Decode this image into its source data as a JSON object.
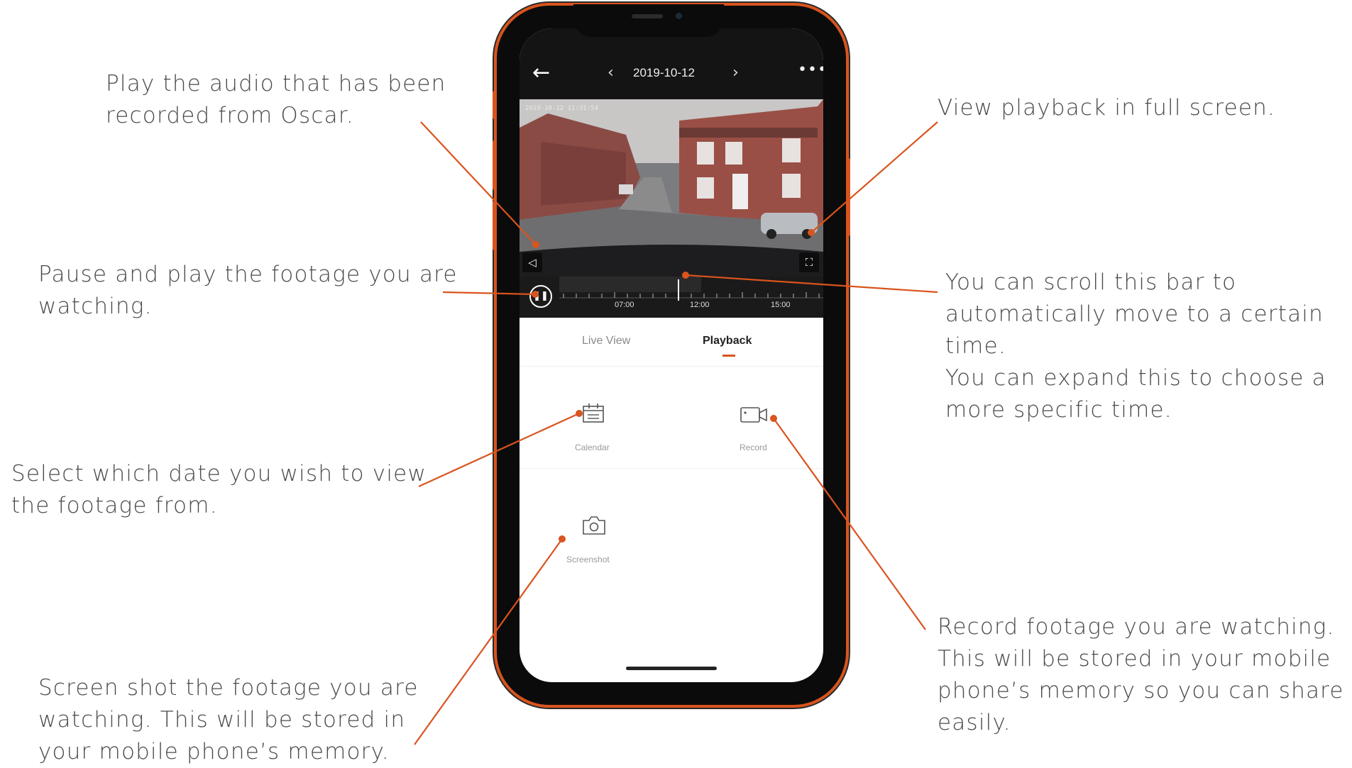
{
  "annotations": {
    "audio": [
      "Play the audio that has been",
      "recorded from Oscar."
    ],
    "fullscreen": [
      "View playback in full screen."
    ],
    "pause": [
      "Pause and play the footage you are",
      "watching."
    ],
    "scroll": [
      "You can scroll this bar to",
      "automatically move to a certain",
      "time.",
      "You can expand this to choose a",
      "more specific time."
    ],
    "calendar": [
      "Select which date you wish to view",
      "the footage from."
    ],
    "record": [
      "Record footage you are watching.",
      "This will be stored in your mobile",
      "phone’s memory so you can share it",
      "easily."
    ],
    "screenshot": [
      "Screen shot the footage you are",
      "watching. This will be stored in",
      "your mobile phone’s memory."
    ]
  },
  "app": {
    "date": "2019-10-12",
    "osd_timestamp": "2019-10-12 11:31:54",
    "timeline_labels": [
      "07:00",
      "12:00",
      "15:00"
    ],
    "tabs": [
      "Live View",
      "Playback"
    ],
    "active_tab": "Playback",
    "tiles": {
      "calendar": "Calendar",
      "record": "Record",
      "screenshot": "Screenshot"
    }
  },
  "colors": {
    "accent": "#d9541e",
    "text": "#4a4a4a"
  }
}
